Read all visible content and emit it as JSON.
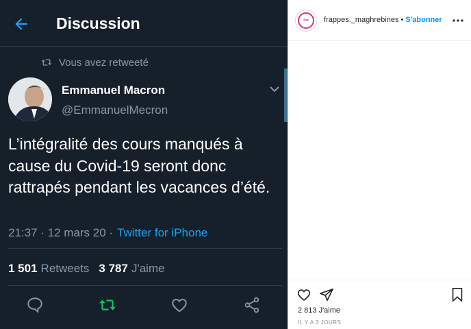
{
  "tweet": {
    "header_title": "Discussion",
    "retweet_notice": "Vous avez retweeté",
    "author_name": "Emmanuel Macron",
    "author_handle": "@EmmanuelMecron",
    "text": "L’intégralité des cours manqués à cause du Covid-19 seront donc rattrapés pendant les vacances d’été.",
    "time": "21:37 · 12 mars 20 ·",
    "source": "Twitter for iPhone",
    "retweets_count": "1 501",
    "retweets_label": "Retweets",
    "likes_count": "3 787",
    "likes_label": "J'aime",
    "colors": {
      "background": "#15202b",
      "accent": "#1da1f2",
      "retweet_green": "#17bf63",
      "muted": "#8899a6"
    },
    "icons": [
      "back-arrow-icon",
      "retweet-icon",
      "chevron-down-icon",
      "reply-icon",
      "retweet-icon",
      "like-icon",
      "share-icon"
    ]
  },
  "instagram": {
    "username": "frappes._maghrebines",
    "separator": "•",
    "follow_label": "S'abonner",
    "likes": "2 813 J'aime",
    "posted": "IL Y A 3 JOURS",
    "colors": {
      "follow": "#0095f6"
    },
    "icons": [
      "more-options-icon",
      "heart-icon",
      "send-icon",
      "bookmark-icon"
    ]
  }
}
